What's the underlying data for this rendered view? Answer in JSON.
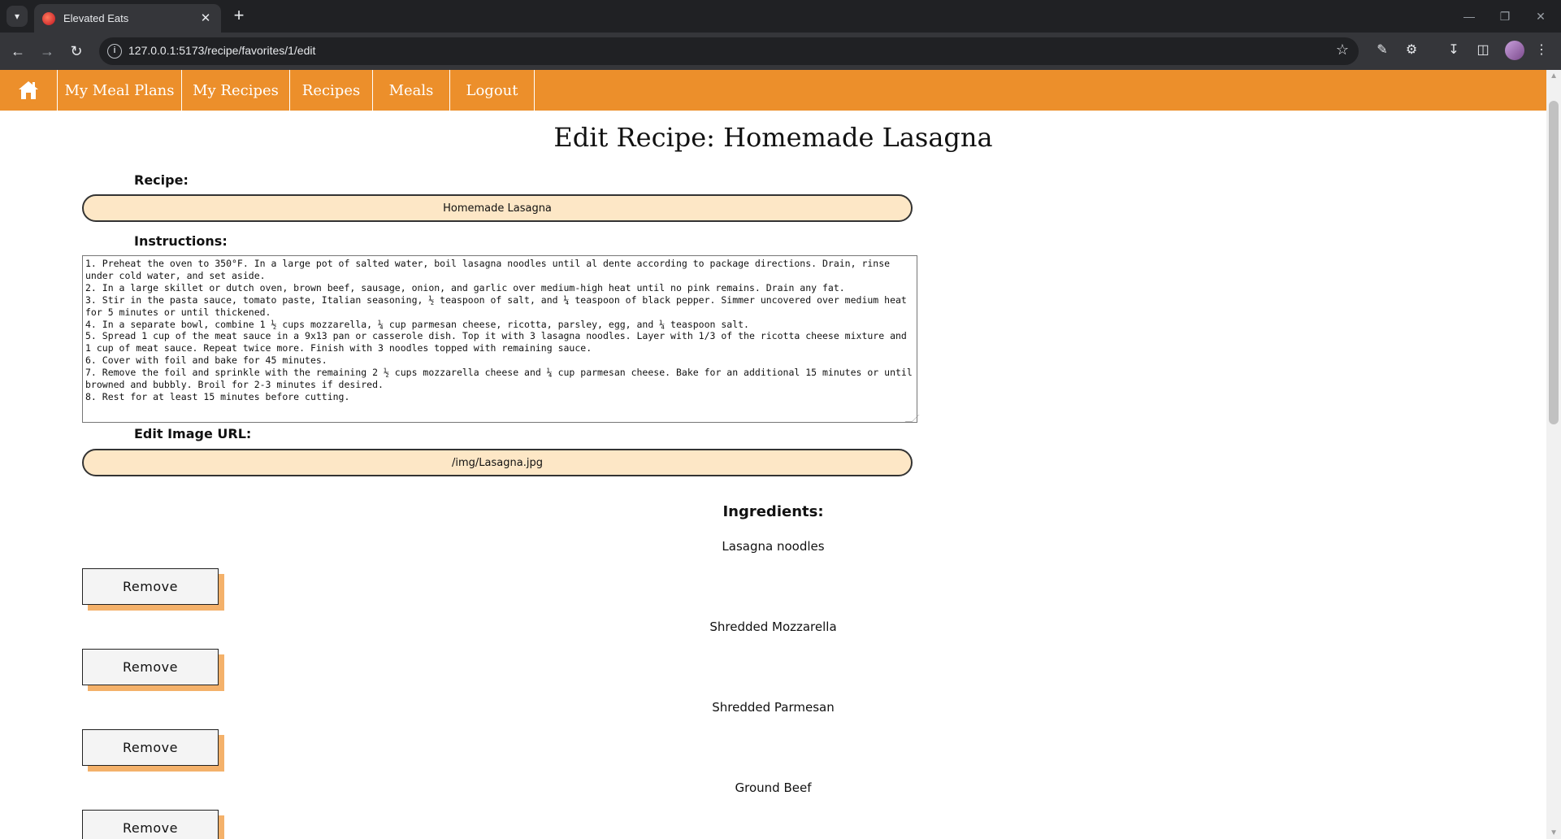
{
  "browser": {
    "tab_title": "Elevated Eats",
    "url": "127.0.0.1:5173/recipe/favorites/1/edit"
  },
  "nav": {
    "links": [
      "My Meal Plans",
      "My Recipes",
      "Recipes",
      "Meals",
      "Logout"
    ]
  },
  "page": {
    "title": "Edit Recipe: Homemade Lasagna"
  },
  "form": {
    "recipe_label": "Recipe:",
    "recipe_value": "Homemade Lasagna",
    "instructions_label": "Instructions:",
    "instructions_value": "1. Preheat the oven to 350°F. In a large pot of salted water, boil lasagna noodles until al dente according to package directions. Drain, rinse under cold water, and set aside.\n2. In a large skillet or dutch oven, brown beef, sausage, onion, and garlic over medium-high heat until no pink remains. Drain any fat.\n3. Stir in the pasta sauce, tomato paste, Italian seasoning, ½ teaspoon of salt, and ¼ teaspoon of black pepper. Simmer uncovered over medium heat for 5 minutes or until thickened.\n4. In a separate bowl, combine 1 ½ cups mozzarella, ¼ cup parmesan cheese, ricotta, parsley, egg, and ¼ teaspoon salt.\n5. Spread 1 cup of the meat sauce in a 9x13 pan or casserole dish. Top it with 3 lasagna noodles. Layer with 1/3 of the ricotta cheese mixture and 1 cup of meat sauce. Repeat twice more. Finish with 3 noodles topped with remaining sauce.\n6. Cover with foil and bake for 45 minutes.\n7. Remove the foil and sprinkle with the remaining 2 ½ cups mozzarella cheese and ¼ cup parmesan cheese. Bake for an additional 15 minutes or until browned and bubbly. Broil for 2-3 minutes if desired.\n8. Rest for at least 15 minutes before cutting.",
    "image_label": "Edit Image URL:",
    "image_value": "/img/Lasagna.jpg"
  },
  "ingredients": {
    "heading": "Ingredients:",
    "remove_label": "Remove",
    "items": [
      {
        "name": "Lasagna noodles"
      },
      {
        "name": "Shredded Mozzarella"
      },
      {
        "name": "Shredded Parmesan"
      },
      {
        "name": "Ground Beef"
      }
    ]
  }
}
